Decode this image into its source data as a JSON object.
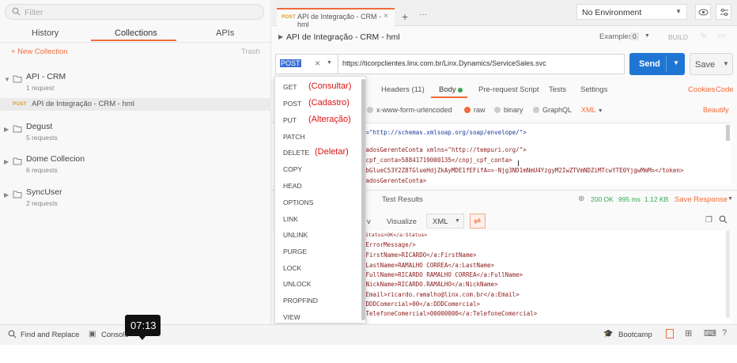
{
  "sidebar": {
    "search_placeholder": "Filter",
    "tabs": [
      "History",
      "Collections",
      "APIs"
    ],
    "new_collection": "+ New Collection",
    "trash": "Trash",
    "collections": [
      {
        "name": "API - CRM",
        "sub": "1 request"
      },
      {
        "name": "Degust",
        "sub": "5 requests"
      },
      {
        "name": "Dome Collecion",
        "sub": "6 requests"
      },
      {
        "name": "SyncUser",
        "sub": "2 requests"
      }
    ],
    "request_item": {
      "method": "POST",
      "name": "API de Integração - CRM - hml"
    }
  },
  "tabbar": {
    "tab": {
      "method": "POST",
      "name": "API de Integração - CRM - hml"
    },
    "environment": "No Environment"
  },
  "request": {
    "title": "API de Integração - CRM - hml",
    "examples_label": "Examples",
    "examples_count": "0",
    "build": "BUILD",
    "method": "POST",
    "url": "https://ticorpclientes.linx.com.br/Linx.Dynamics/ServiceSales.svc",
    "send": "Send",
    "save": "Save",
    "subtabs": [
      "Headers (11)",
      "Body",
      "Pre-request Script",
      "Tests",
      "Settings"
    ],
    "cookies": "Cookies",
    "code": "Code",
    "body_modes": [
      "x-www-form-urlencoded",
      "raw",
      "binary",
      "GraphQL"
    ],
    "format": "XML",
    "beautify": "Beautify"
  },
  "body_code": [
    "s=\"http://schemas.xmlsoap.org/soap/envelope/\">",
    "",
    "DadosGerenteConta xmlns=\"http://tempuri.org/\">",
    "_cpf_conta>58841719000135</cnpj_cpf_conta>",
    ">bGlueC53Y2Z8TGlueHdjZkAyMDE1fEFifA==-Njg3ND1mNmU4YzgyM2IwZTVmNDZiMTcwYTE0YjgwMmM=</token>",
    "DadosGerenteConta>"
  ],
  "response": {
    "tab": "Test Results",
    "status": "200 OK",
    "time": "995 ms",
    "size": "1.12 KB",
    "save_response": "Save Response",
    "view_visualize": "Visualize",
    "view_partial": "v",
    "format": "XML",
    "lines": [
      ":Status>OK</a:Status>",
      ":ErrorMessage/>",
      ":FirstName>RICARDO</a:FirstName>",
      ":LastName>RAMALHO CORREA</a:LastName>",
      ":FullName>RICARDO RAMALHO CORREA</a:FullName>",
      ":NickName>RICARDO.RAMALHO</a:NickName>",
      ":Email>ricardo.ramalho@linx.com.br</a:Email>",
      ":DDDComercial>00</a:DDDComercial>",
      ":TelefoneComercial>00000000</a:TelefoneComercial>"
    ]
  },
  "dropdown": {
    "items": [
      "GET",
      "POST",
      "PUT",
      "PATCH",
      "DELETE",
      "COPY",
      "HEAD",
      "OPTIONS",
      "LINK",
      "UNLINK",
      "PURGE",
      "LOCK",
      "UNLOCK",
      "PROPFIND",
      "VIEW"
    ],
    "notes": {
      "GET": "(Consultar)",
      "POST": "(Cadastro)",
      "PUT": "(Alteração)",
      "DELETE": "(Deletar)"
    }
  },
  "footer": {
    "find_replace": "Find and Replace",
    "console": "Console",
    "bootcamp": "Bootcamp"
  },
  "tooltip": "07:13",
  "colors": {
    "accent": "#f26b3a",
    "send": "#1f76d2",
    "annotation": "#dd1111"
  }
}
